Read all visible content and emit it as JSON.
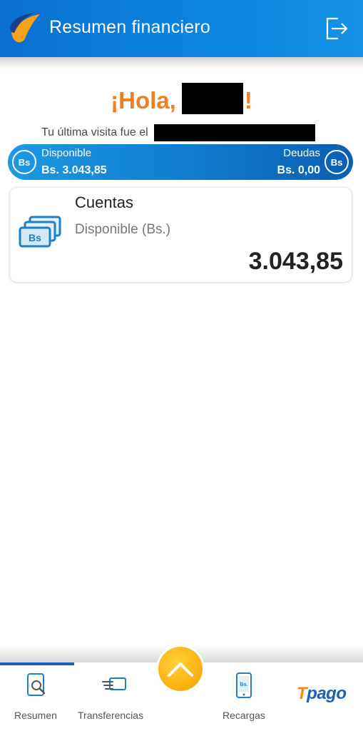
{
  "header": {
    "title": "Resumen financiero",
    "logout_icon": "logout-icon"
  },
  "greeting": {
    "text": "¡Hola,",
    "exclamation": "!"
  },
  "last_visit": {
    "text": "Tu última visita fue el"
  },
  "balance": {
    "currency_badge": "Bs",
    "available_label": "Disponible",
    "available_value": "Bs. 3.043,85",
    "debts_label": "Deudas",
    "debts_value": "Bs. 0,00"
  },
  "accounts_card": {
    "title": "Cuentas",
    "subtitle": "Disponible (Bs.)",
    "amount": "3.043,85",
    "icon": "bs-bills-icon",
    "icon_text": "Bs"
  },
  "nav": {
    "items": [
      {
        "label": "Resumen",
        "icon": "search-document-icon",
        "active": true
      },
      {
        "label": "Transferencias",
        "icon": "transfer-icon",
        "active": false
      },
      {
        "label": "",
        "icon": "chevron-up-icon",
        "active": false
      },
      {
        "label": "Recargas",
        "icon": "mobile-recharge-icon",
        "active": false
      },
      {
        "label": "",
        "icon": "tpago-logo",
        "active": false
      }
    ],
    "phone_icon_text": "Bs.",
    "tpago_logo": {
      "t": "T",
      "rest": "pago"
    }
  },
  "colors": {
    "header_blue": "#0c86e0",
    "greeting_orange": "#f07f22",
    "nav_active": "#1565c0",
    "fab_yellow": "#fbb313",
    "tpago_orange": "#f08a1d",
    "tpago_blue": "#1d5fb4"
  }
}
